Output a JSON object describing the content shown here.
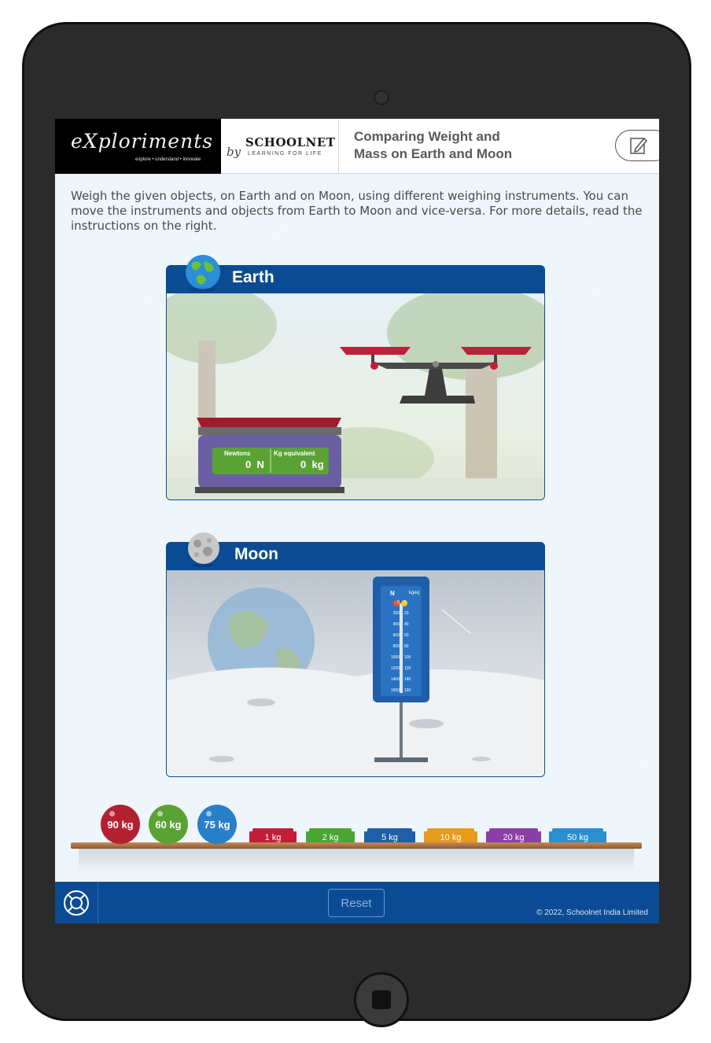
{
  "header": {
    "logo_text": "eXploriments",
    "logo_tagline": "explore • understand • innovate",
    "by": "by",
    "partner_name": "SCHOOLNET",
    "partner_tagline": "LEARNING FOR LIFE",
    "title_line1": "Comparing Weight and",
    "title_line2": "Mass on Earth and Moon"
  },
  "instructions": "Weigh the given objects, on Earth and on Moon, using different weighing instruments. You can move the instruments and objects from Earth to Moon and vice-versa. For more details, read the instructions on the right.",
  "earth_panel": {
    "title": "Earth",
    "digital_scale": {
      "label_left": "Newtons",
      "label_right": "Kg equivalent",
      "value_newtons": "0",
      "unit_newtons": "N",
      "value_kg": "0",
      "unit_kg": "kg"
    }
  },
  "moon_panel": {
    "title": "Moon",
    "spring_balance": {
      "unit_left": "N",
      "unit_right": "kgeq",
      "left_ticks": [
        "0",
        "200",
        "400",
        "600",
        "800",
        "1000",
        "1200",
        "1400",
        "1600"
      ],
      "right_ticks": [
        "0",
        "20",
        "40",
        "60",
        "80",
        "100",
        "120",
        "140",
        "160"
      ]
    }
  },
  "objects": {
    "balls": [
      {
        "label": "90 kg",
        "color": "#b3202f"
      },
      {
        "label": "60 kg",
        "color": "#5aa234"
      },
      {
        "label": "75 kg",
        "color": "#2a7fc9"
      }
    ],
    "blocks": [
      {
        "label": "1 kg",
        "color": "#c21e3a"
      },
      {
        "label": "2 kg",
        "color": "#4aa532"
      },
      {
        "label": "5 kg",
        "color": "#1f5fa8"
      },
      {
        "label": "10 kg",
        "color": "#e89a1c"
      },
      {
        "label": "20 kg",
        "color": "#8b3fa6"
      },
      {
        "label": "50 kg",
        "color": "#2a8fcf"
      }
    ]
  },
  "footer": {
    "reset_label": "Reset",
    "copyright": "© 2022, Schoolnet India Limited"
  },
  "colors": {
    "primary": "#0a4b94",
    "background": "#eef6fc"
  }
}
